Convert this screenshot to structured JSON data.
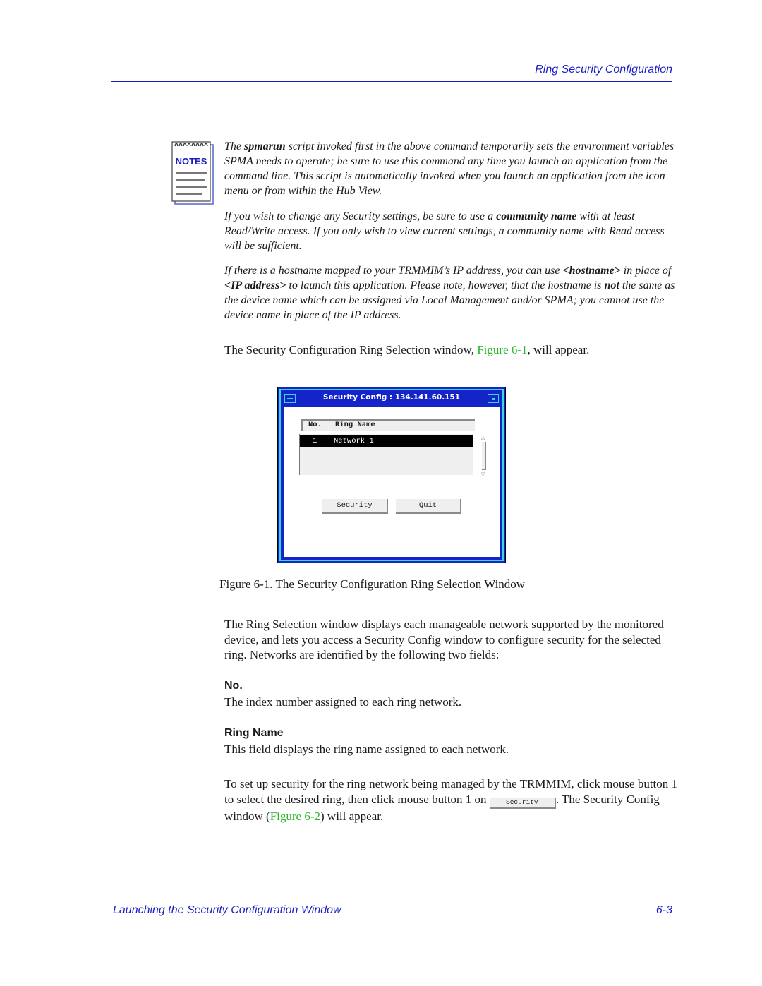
{
  "header": {
    "title": "Ring Security Configuration"
  },
  "notes": {
    "icon_label": "NOTES",
    "paragraphs": [
      {
        "pre": "The ",
        "bold": "spmarun",
        "post": " script invoked first in the above command temporarily sets the environment variables SPMA needs to operate; be sure to use this command any time you launch an application from the command line. This script is automatically invoked when you launch an application from the icon menu or from within the Hub View."
      },
      {
        "pre": "If you wish to change any Security settings, be sure to use a ",
        "bold": "community name",
        "post": " with at least Read/Write access. If you only wish to view current settings, a community name with Read access will be sufficient."
      },
      {
        "s1": "If there is a hostname mapped to your TRMMIM’s IP address, you can use ",
        "b1": "<hostname>",
        "s2": " in place of ",
        "b2": "<IP address>",
        "s3": " to launch this application. Please note, however, that the hostname is ",
        "b3": "not",
        "s4": " the same as the device name which can be assigned via Local Management and/or SPMA; you cannot use the device name in place of the IP address."
      }
    ]
  },
  "intro": {
    "pre": "The Security Configuration Ring Selection window, ",
    "link": "Figure 6-1",
    "post": ", will appear."
  },
  "window": {
    "title": "Security Config : 134.141.60.151",
    "columns": {
      "no": "No.",
      "ring_name": "Ring Name"
    },
    "rows": [
      {
        "no": "1",
        "ring_name": "Network 1",
        "selected": true
      }
    ],
    "buttons": {
      "security": "Security",
      "quit": "Quit"
    }
  },
  "caption": "Figure 6-1.  The Security Configuration Ring Selection Window",
  "description": "The Ring Selection window displays each manageable network supported by the monitored device, and lets you access a Security Config window to configure security for the selected ring. Networks are identified by the following two fields:",
  "fields": [
    {
      "label": "No.",
      "desc": "The index number assigned to each ring network."
    },
    {
      "label": "Ring Name",
      "desc": "This field displays the ring name assigned to each network."
    }
  ],
  "setup": {
    "pre": "To set up security for the ring network being managed by the TRMMIM, click mouse button 1 to select the desired ring, then click mouse button 1 on ",
    "button": "Security",
    "mid": ". The Security Config window (",
    "link": "Figure 6-2",
    "post": ") will appear."
  },
  "footer": {
    "title": "Launching the Security Configuration Window",
    "page": "6-3"
  },
  "colors": {
    "accent_blue": "#1a1fc4",
    "link_green": "#2cb52c",
    "window_blue": "#1424c8",
    "window_cyan": "#3ad6e0"
  }
}
